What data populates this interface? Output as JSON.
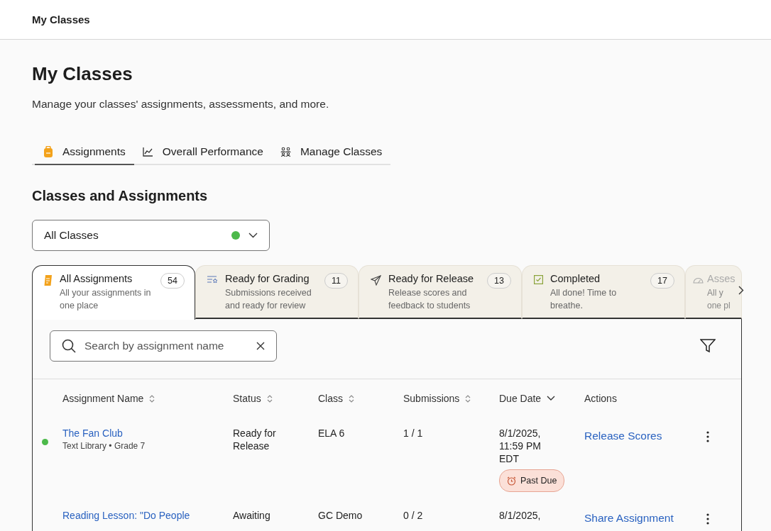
{
  "top_bar": {
    "title": "My Classes"
  },
  "page": {
    "title": "My Classes",
    "subtitle": "Manage your classes' assignments, assessments, and more."
  },
  "nav_tabs": [
    {
      "label": "Assignments",
      "selected": true
    },
    {
      "label": "Overall Performance",
      "selected": false
    },
    {
      "label": "Manage Classes",
      "selected": false
    }
  ],
  "section_title": "Classes and Assignments",
  "class_select": {
    "value": "All Classes"
  },
  "filter_tabs": [
    {
      "title": "All Assignments",
      "description": "All your assignments in one place",
      "count": "54",
      "selected": true,
      "faded": false
    },
    {
      "title": "Ready for Grading",
      "description": "Submissions received and ready for review",
      "count": "11",
      "selected": false,
      "faded": false
    },
    {
      "title": "Ready for Release",
      "description": "Release scores and feedback to students",
      "count": "13",
      "selected": false,
      "faded": false
    },
    {
      "title": "Completed",
      "description": "All done! Time to breathe.",
      "count": "17",
      "selected": false,
      "faded": false
    },
    {
      "title": "Asses",
      "description": "All y\none pl",
      "selected": false,
      "faded": true
    }
  ],
  "search": {
    "placeholder": "Search by assignment name"
  },
  "table": {
    "columns": [
      {
        "label": "Assignment Name",
        "sortable": true,
        "sorted": false
      },
      {
        "label": "Status",
        "sortable": true,
        "sorted": false
      },
      {
        "label": "Class",
        "sortable": true,
        "sorted": false
      },
      {
        "label": "Submissions",
        "sortable": true,
        "sorted": false
      },
      {
        "label": "Due Date",
        "sortable": true,
        "sorted": true
      },
      {
        "label": "Actions",
        "sortable": false
      }
    ],
    "rows": [
      {
        "new": true,
        "name": "The Fan Club",
        "meta": "Text Library • Grade 7",
        "status": "Ready for Release",
        "class": "ELA 6",
        "submissions": "1 / 1",
        "due": "8/1/2025, 11:59 PM EDT",
        "badge": "Past Due",
        "action": "Release Scores"
      },
      {
        "new": false,
        "name": "Reading Lesson: \"Do People",
        "status": "Awaiting",
        "class": "GC Demo",
        "submissions": "0 / 2",
        "due": "8/1/2025,",
        "action": "Share Assignment"
      }
    ]
  }
}
